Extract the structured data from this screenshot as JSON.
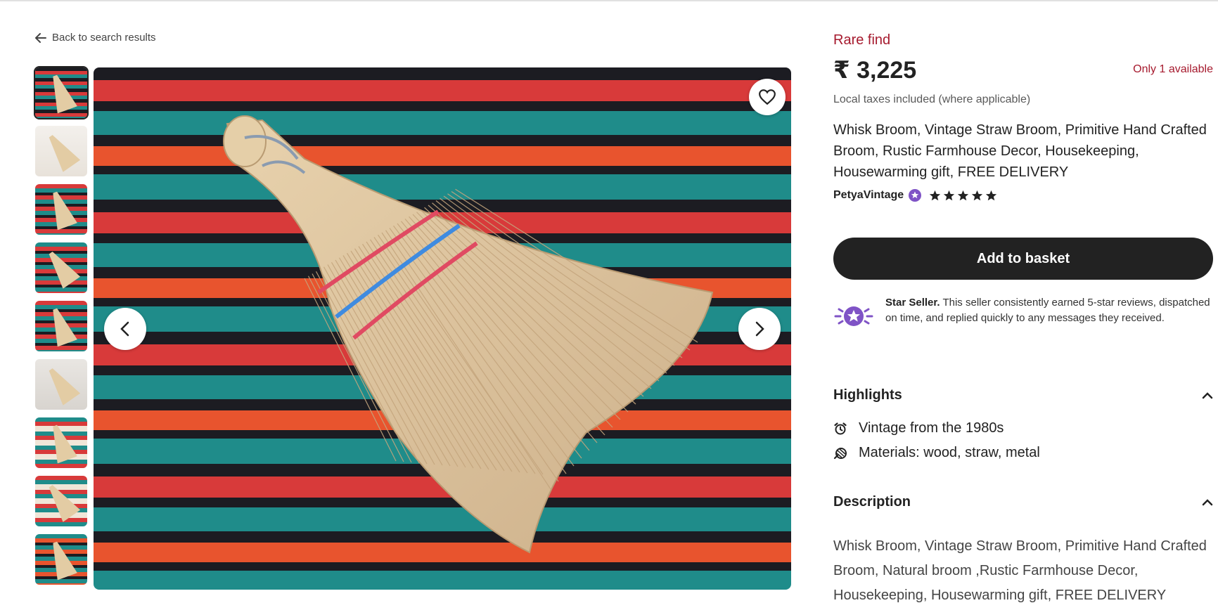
{
  "nav": {
    "back_label": "Back to search results"
  },
  "gallery": {
    "thumbnail_count": 9,
    "active_index": 0
  },
  "listing": {
    "badge": "Rare find",
    "price": "₹ 3,225",
    "availability": "Only 1 available",
    "taxes_note": "Local taxes included (where applicable)",
    "title": "Whisk Broom, Vintage Straw Broom, Primitive Hand Crafted Broom, Rustic Farmhouse Decor, Housekeeping, Housewarming gift, FREE DELIVERY",
    "shop_name": "PetyaVintage",
    "rating_stars": 5,
    "add_to_basket_label": "Add to basket"
  },
  "star_seller": {
    "heading": "Star Seller.",
    "text": "This seller consistently earned 5-star reviews, dispatched on time, and replied quickly to any messages they received."
  },
  "highlights": {
    "heading": "Highlights",
    "items": [
      {
        "icon": "alarm-clock-icon",
        "text": "Vintage from the 1980s"
      },
      {
        "icon": "materials-icon",
        "text": "Materials: wood, straw, metal"
      }
    ]
  },
  "description": {
    "heading": "Description",
    "text": "Whisk Broom, Vintage Straw Broom, Primitive Hand Crafted Broom, Natural broom ,Rustic Farmhouse Decor, Housekeeping, Housewarming gift, FREE DELIVERY"
  },
  "colors": {
    "accent_red": "#a61a2e",
    "button_dark": "#222222",
    "star_seller_purple": "#7f53c6"
  }
}
